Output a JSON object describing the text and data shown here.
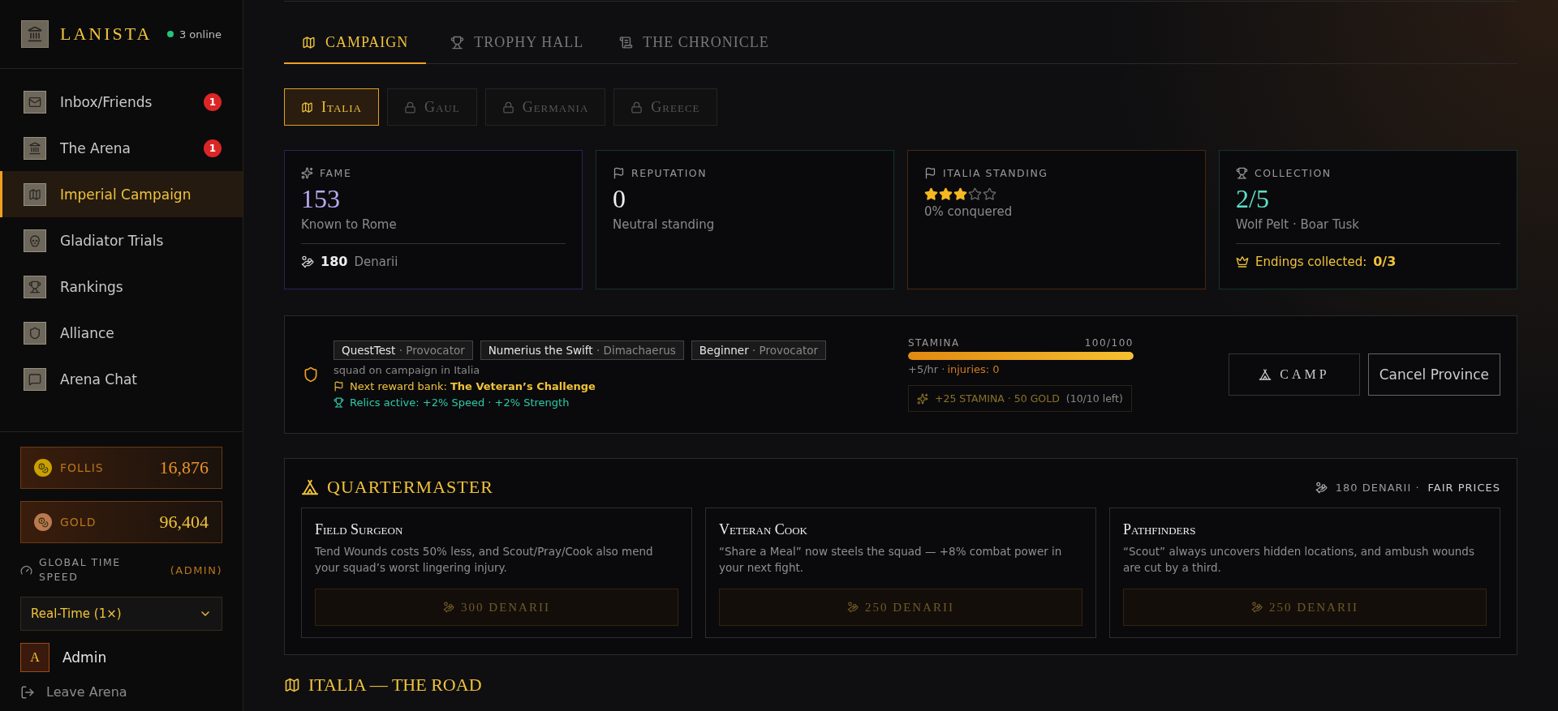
{
  "sidebar": {
    "brand": "LANISTA",
    "online": "3 online",
    "nav": [
      {
        "kind": "mail",
        "label": "Inbox/Friends",
        "badge": "1",
        "selected": false
      },
      {
        "kind": "arena",
        "label": "The Arena",
        "badge": "1",
        "selected": false
      },
      {
        "kind": "map",
        "label": "Imperial Campaign",
        "selected": true
      },
      {
        "kind": "skull",
        "label": "Gladiator Trials",
        "selected": false
      },
      {
        "kind": "trophy",
        "label": "Rankings",
        "selected": false
      },
      {
        "kind": "shield",
        "label": "Alliance",
        "selected": false
      },
      {
        "kind": "chat",
        "label": "Arena Chat",
        "selected": false
      }
    ],
    "currencies": [
      {
        "kind": "follis",
        "label": "FOLLIS",
        "value": "16,876"
      },
      {
        "kind": "gold",
        "label": "GOLD",
        "value": "96,404"
      }
    ],
    "time_speed": {
      "label": "GLOBAL TIME SPEED",
      "tag": "(ADMIN)",
      "value": "Real-Time (1×)"
    },
    "user": {
      "initial": "A",
      "name": "Admin"
    },
    "leave": "Leave Arena"
  },
  "tabs": [
    {
      "kind": "map",
      "label": "CAMPAIGN",
      "selected": true
    },
    {
      "kind": "trophy",
      "label": "TROPHY HALL",
      "selected": false
    },
    {
      "kind": "scroll",
      "label": "THE CHRONICLE",
      "selected": false
    }
  ],
  "regions": [
    {
      "label": "Italia",
      "locked": false,
      "selected": true
    },
    {
      "label": "Gaul",
      "locked": true,
      "selected": false
    },
    {
      "label": "Germania",
      "locked": true,
      "selected": false
    },
    {
      "label": "Greece",
      "locked": true,
      "selected": false
    }
  ],
  "stats": [
    {
      "kind": "fame",
      "label": "FAME",
      "value": "153",
      "caption": "Known to Rome",
      "footer_value": "180",
      "footer_label": "Denarii"
    },
    {
      "kind": "reputation",
      "label": "REPUTATION",
      "value": "0",
      "caption": "Neutral standing"
    },
    {
      "kind": "standing",
      "label": "ITALIA STANDING",
      "stars": 3,
      "caption": "0% conquered"
    },
    {
      "kind": "collection",
      "label": "COLLECTION",
      "value": "2/5",
      "caption": "Wolf Pelt · Boar Tusk",
      "footer_label": "Endings collected:",
      "footer_value": "0/3"
    }
  ],
  "squad": {
    "members": [
      {
        "name": "QuestTest",
        "role": "· Provocator"
      },
      {
        "name": "Numerius the Swift",
        "role": "· Dimachaerus"
      },
      {
        "name": "Beginner",
        "role": "· Provocator"
      }
    ],
    "status": "squad on campaign in Italia",
    "reward_label": "Next reward bank:",
    "reward_value": "The Veteran’s Challenge",
    "relics": "Relics active: +2% Speed · +2% Strength",
    "stamina": {
      "label": "STAMINA",
      "reading": "100/100",
      "level": 1,
      "rate": "+5/hr ·",
      "injuries": "injuries: 0"
    },
    "bonus": {
      "text": "+25 STAMINA · 50 GOLD",
      "note": "(10/10 left)"
    },
    "buttons": [
      {
        "kind": "camp",
        "label": "CAMP"
      },
      {
        "kind": "cancel",
        "label": "Cancel Province"
      }
    ]
  },
  "quartermaster": {
    "title": "QUARTERMASTER",
    "funds": "180 DENARII ·",
    "note": "FAIR PRICES",
    "offers": [
      {
        "title": "Field Surgeon",
        "text": "Tend Wounds costs 50% less, and Scout/Pray/Cook also mend your squad’s worst lingering injury.",
        "price": "300 DENARII"
      },
      {
        "title": "Veteran Cook",
        "text": "“Share a Meal” now steels the squad — +8% combat power in your next fight.",
        "price": "250 DENARII"
      },
      {
        "title": "Pathfinders",
        "text": "“Scout” always uncovers hidden locations, and ambush wounds are cut by a third.",
        "price": "250 DENARII"
      }
    ]
  },
  "road_title": "ITALIA — THE ROAD"
}
